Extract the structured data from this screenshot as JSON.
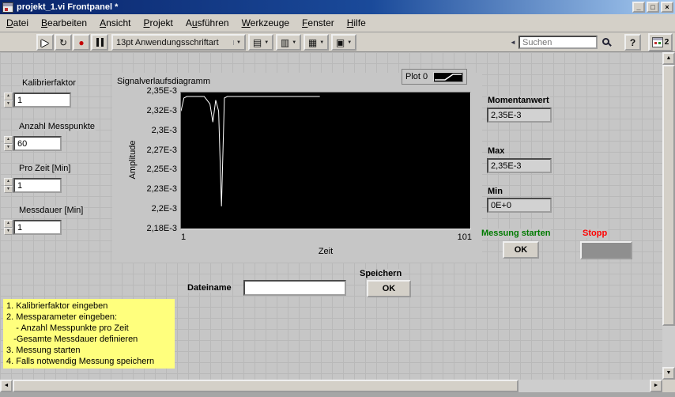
{
  "window": {
    "title": "projekt_1.vi Frontpanel *",
    "controls": {
      "minimize": "_",
      "maximize": "□",
      "close": "×"
    }
  },
  "menu": {
    "items": [
      {
        "pre": "",
        "accel": "D",
        "post": "atei"
      },
      {
        "pre": "",
        "accel": "B",
        "post": "earbeiten"
      },
      {
        "pre": "",
        "accel": "A",
        "post": "nsicht"
      },
      {
        "pre": "",
        "accel": "P",
        "post": "rojekt"
      },
      {
        "pre": "A",
        "accel": "u",
        "post": "sführen"
      },
      {
        "pre": "",
        "accel": "W",
        "post": "erkzeuge"
      },
      {
        "pre": "",
        "accel": "F",
        "post": "enster"
      },
      {
        "pre": "",
        "accel": "H",
        "post": "ilfe"
      }
    ]
  },
  "toolbar": {
    "font_selector": "13pt Anwendungsschriftart",
    "search": {
      "placeholder": "Suchen"
    },
    "help_label": "?",
    "window_badge": "2"
  },
  "icons": {
    "run": "▶",
    "continuous_run": "↻",
    "abort": "●",
    "dropdown_arrow": "▼",
    "align_objects": "▤",
    "distribute_objects": "▥",
    "resize_objects": "▦",
    "reorder_objects": "▣",
    "search_collapse": "◄",
    "up": "▲",
    "down": "▼",
    "left": "◄",
    "right": "►"
  },
  "controls": {
    "items": [
      {
        "label": "Kalibrierfaktor",
        "value": "1"
      },
      {
        "label": "Anzahl Messpunkte",
        "value": "60"
      },
      {
        "label": "Pro Zeit [Min]",
        "value": "1"
      },
      {
        "label": "Messdauer [Min]",
        "value": "1"
      }
    ]
  },
  "indicators": {
    "momentanwert": {
      "label": "Momentanwert",
      "value": "2,35E-3"
    },
    "max": {
      "label": "Max",
      "value": "2,35E-3"
    },
    "min": {
      "label": "Min",
      "value": "0E+0"
    }
  },
  "actions": {
    "start": {
      "label": "Messung starten",
      "button": "OK",
      "label_color": "#007a00"
    },
    "stop": {
      "label": "Stopp",
      "label_color": "#ff0000"
    },
    "save": {
      "label": "Speichern",
      "button": "OK"
    },
    "filename": {
      "label": "Dateiname",
      "value": ""
    }
  },
  "note": {
    "background": "#ffff7d",
    "lines": [
      "1. Kalibrierfaktor eingeben",
      "2. Messparameter eingeben:",
      "    - Anzahl Messpunkte pro Zeit",
      "   -Gesamte Messdauer definieren",
      "3. Messung starten",
      "4. Falls notwendig Messung speichern"
    ]
  },
  "chart_data": {
    "type": "line",
    "title": "Signalverlaufsdiagramm",
    "xlabel": "Zeit",
    "ylabel": "Amplitude",
    "legend": [
      {
        "name": "Plot 0"
      }
    ],
    "legend_position": "top-right",
    "plot_bg": "#000000",
    "line_color": "#ffffff",
    "grid": false,
    "x_range": [
      1,
      101
    ],
    "y_range": [
      0.002175,
      0.00235
    ],
    "x_tick_labels": [
      "1",
      "101"
    ],
    "y_tick_labels": [
      "2,35E-3",
      "2,32E-3",
      "2,3E-3",
      "2,27E-3",
      "2,25E-3",
      "2,23E-3",
      "2,2E-3",
      "2,18E-3"
    ],
    "series": [
      {
        "name": "Plot 0",
        "x": [
          1,
          2,
          3,
          5,
          7,
          9,
          10,
          11,
          12,
          13,
          14,
          15,
          16,
          17,
          20,
          25,
          30,
          35,
          40,
          45,
          49
        ],
        "y": [
          0.00233,
          0.002348,
          0.00235,
          0.00235,
          0.00235,
          0.00235,
          0.002345,
          0.00234,
          0.002315,
          0.002345,
          0.00233,
          0.0022,
          0.002348,
          0.00235,
          0.00235,
          0.00235,
          0.00235,
          0.00235,
          0.00235,
          0.00235,
          0.00235
        ]
      }
    ]
  }
}
